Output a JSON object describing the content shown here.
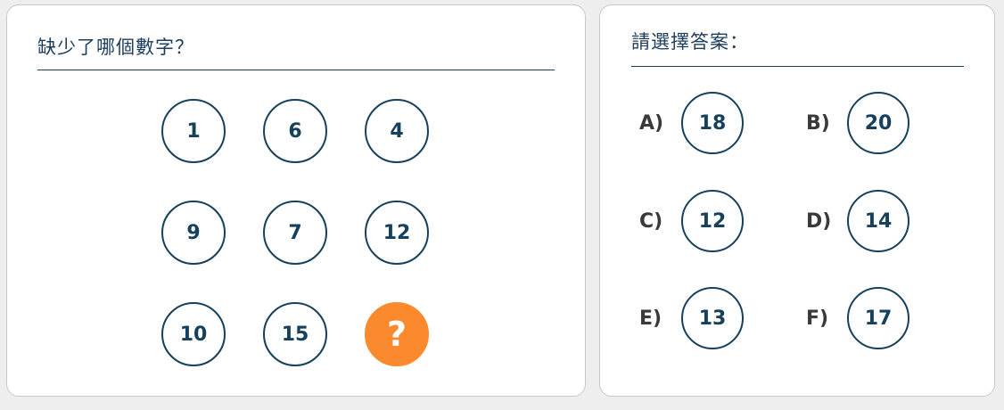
{
  "puzzle": {
    "title": "缺少了哪個數字？",
    "grid": [
      {
        "value": "1"
      },
      {
        "value": "6"
      },
      {
        "value": "4"
      },
      {
        "value": "9"
      },
      {
        "value": "7"
      },
      {
        "value": "12"
      },
      {
        "value": "10"
      },
      {
        "value": "15"
      },
      {
        "value": "?",
        "missing": true
      }
    ],
    "missing_color": "#fb8a2e",
    "accent_color": "#16405c"
  },
  "answers": {
    "title": "請選擇答案：",
    "options": [
      {
        "label": "A)",
        "value": "18"
      },
      {
        "label": "B)",
        "value": "20"
      },
      {
        "label": "C)",
        "value": "12"
      },
      {
        "label": "D)",
        "value": "14"
      },
      {
        "label": "E)",
        "value": "13"
      },
      {
        "label": "F)",
        "value": "17"
      }
    ]
  }
}
